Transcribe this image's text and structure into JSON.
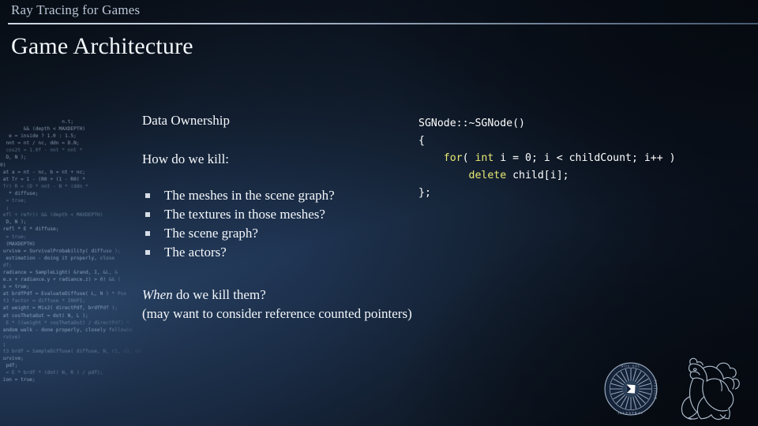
{
  "header": {
    "deck_title": "Ray Tracing for Games",
    "slide_title": "Game Architecture"
  },
  "body": {
    "lead_1": "Data Ownership",
    "lead_2": "How do we kill:",
    "bullets": [
      "The meshes in the scene graph?",
      "The textures in those meshes?",
      "The scene graph?",
      "The actors?"
    ],
    "closing_emphasis": "When",
    "closing_rest": " do we kill them?",
    "closing_note": "(may want to consider reference counted pointers)"
  },
  "code": {
    "line_1": "SGNode::~SGNode()",
    "line_2": "{",
    "line_3_kw_1": "for",
    "line_3_a": "( ",
    "line_3_kw_2": "int",
    "line_3_b": " i = 0; i < childCount; i++ )",
    "line_4_kw": "delete",
    "line_4_rest": " child[i];",
    "line_5": "};"
  },
  "background_code": {
    "lines": [
      "                     n.t;",
      "        && (depth < MAXDEPTH)",
      "",
      "   e = inside ? 1.0 : 1.5;",
      "  nnt = nt / nc, ddn = D.N;",
      "  cos2t = 1.0f - nnt * nnt *",
      "  D, N );",
      "0)",
      "",
      " at a = nt - nc, b = nt + nc;",
      " at Tr = 1 - (R0 + (1 - R0) *",
      " Tr) R = (D * nnt - N * (ddn *",
      "",
      "   * diffuse;",
      "  = true;",
      "",
      "  ;",
      " efl + refr)) && (depth < MAXDEPTH)",
      "  D, N );",
      " refl * E * diffuse;",
      "  = true;",
      "",
      "  (MAXDEPTH)",
      "",
      " urvive = SurvivalProbability( diffuse );",
      "  estimation - doing it properly, close",
      " df;",
      " radiance = SampleLight( &rand, I, &L, &",
      " e.x + radiance.y + radiance.z) > 0) && (",
      "",
      " s = true;",
      " at brdfPdf = EvaluateDiffuse( L, N ) * Pse",
      " t3 factor = diffuse * INVPI;",
      " at weight = Mis2( directPdf, brdfPdf );",
      " at cosThetaOut = dot( N, L );",
      "  E * ((weight * cosThetaOut) / directPdf) *",
      "",
      " andom walk - done properly, closely followin",
      " rvive)",
      "",
      " ;",
      " t3 brdf = SampleDiffuse( diffuse, N, r1, r2, &R",
      " urvive;",
      "  pdf;",
      "  = E * brdf * (dot( N, R ) / pdf);",
      " ion = true;"
    ]
  },
  "logos": {
    "seal_name": "university-seal-logo",
    "seal_motto": "NOS SOL IUSTITIAE ILLUSTRAT",
    "lion_name": "lion-crest-logo"
  },
  "colors": {
    "background_deep": "#0b1320",
    "background_mid": "#22395a",
    "text_primary": "#f4f7fb",
    "header_text": "#b9c6d6",
    "code_keyword": "#eaea72",
    "code_text": "#ffffff",
    "bullet": "#d6dde6"
  }
}
